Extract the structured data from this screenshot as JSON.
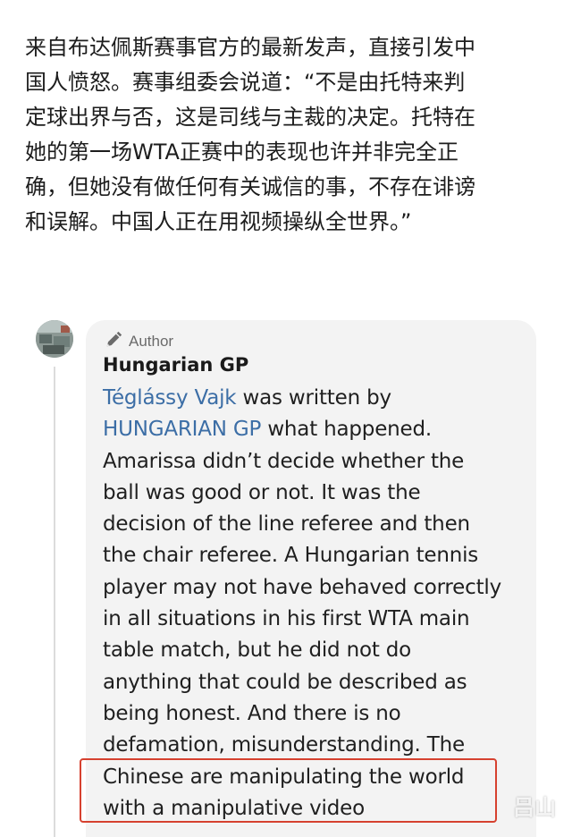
{
  "article": {
    "lines": [
      "来自布达佩斯赛事官方的最新发声，直接引发中",
      "国人愤怒。赛事组委会说道：“不是由托特来判",
      "定球出界与否，这是司线与主裁的决定。托特在",
      "她的第一场WTA正赛中的表现也许并非完全正",
      "确，但她没有做任何有关诚信的事，不存在诽谤",
      "和误解。中国人正在用视频操纵全世界。”"
    ]
  },
  "comment": {
    "badge_label": "Author",
    "badge_icon": "pen-icon",
    "author_name": "Hungarian GP",
    "link_1": "Téglássy Vajk",
    "line_1_tail": " was written by",
    "link_2": "HUNGARIAN GP",
    "line_2_tail": " what happened.",
    "body_lines": [
      "Amarissa didn’t decide whether the",
      "ball was good or not. It was the",
      "decision of the line referee and then",
      "the chair referee. A Hungarian tennis",
      "player may not have behaved correctly",
      "in all situations in his first WTA main",
      "table match, but he did not do",
      "anything that could be described as",
      "being honest. And there is no",
      "defamation, misunderstanding. The"
    ],
    "highlighted_lines": [
      "Chinese are manipulating the world",
      "with a manipulative video"
    ],
    "highlight_color": "#d6412f",
    "link_color": "#3c6ea6"
  },
  "watermark": "吕山"
}
